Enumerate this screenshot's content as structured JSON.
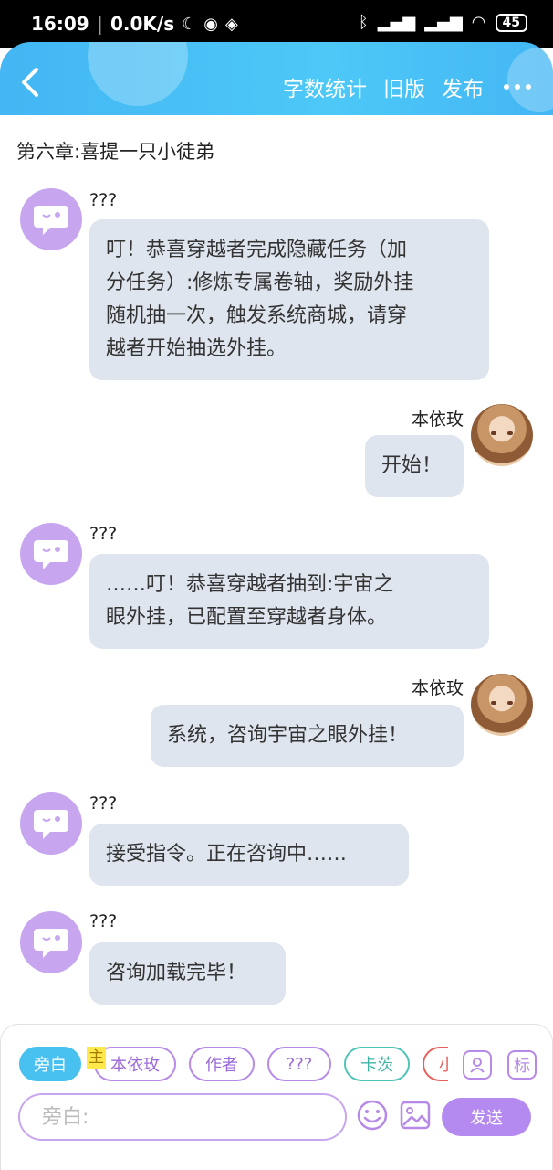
{
  "status_bar": {
    "time": "16:09",
    "speed": "0.0K/s",
    "battery": "45"
  },
  "header": {
    "actions": [
      "字数统计",
      "旧版",
      "发布"
    ]
  },
  "chapter_title": "第六章:喜提一只小徒弟",
  "messages": [
    {
      "side": "left",
      "speaker": "???",
      "text_lines": [
        "叮！恭喜穿越者完成隐藏任务（加",
        "分任务）:修炼专属卷轴，奖励外挂",
        "随机抽一次，触发系统商城，请穿",
        "越者开始抽选外挂。"
      ]
    },
    {
      "side": "right",
      "speaker": "本依玫",
      "text_lines": [
        "开始！"
      ]
    },
    {
      "side": "left",
      "speaker": "???",
      "text_lines": [
        "……叮！恭喜穿越者抽到:宇宙之",
        "眼外挂，已配置至穿越者身体。"
      ]
    },
    {
      "side": "right",
      "speaker": "本依玫",
      "text_lines": [
        "系统，咨询宇宙之眼外挂！"
      ]
    },
    {
      "side": "left",
      "speaker": "???",
      "text_lines": [
        "接受指令。正在咨询中……"
      ]
    },
    {
      "side": "left",
      "speaker": "???",
      "text_lines": [
        "咨询加载完毕！"
      ]
    }
  ],
  "roles": [
    "旁白",
    "本依玫",
    "作者",
    "???",
    "卡茨",
    "小"
  ],
  "main_tag": "主",
  "tools": {
    "role_manage": "",
    "tag": "标"
  },
  "input": {
    "placeholder": "旁白:"
  },
  "send_label": "发送",
  "colors": {
    "accent_blue": "#49c1f0",
    "accent_purple": "#b58af0",
    "bubble_gray": "#dfe5ee"
  }
}
